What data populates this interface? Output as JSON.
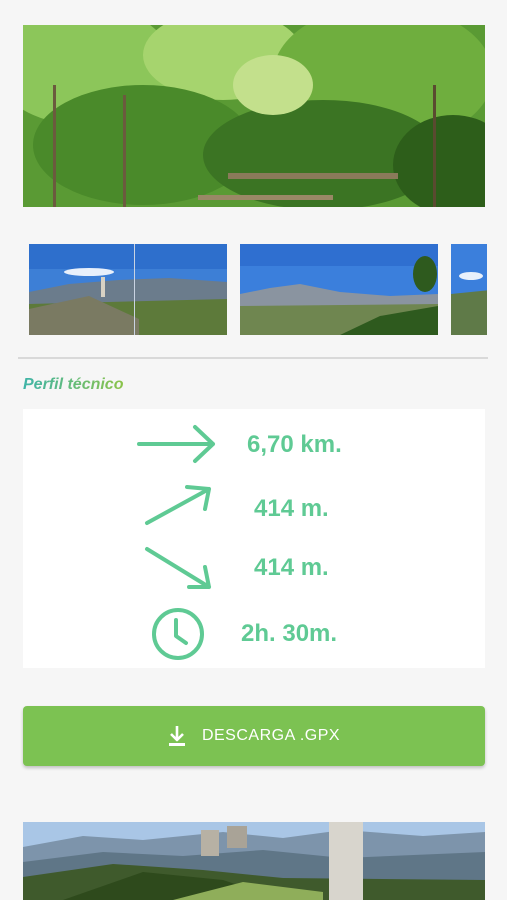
{
  "section": {
    "title": "Perfil técnico"
  },
  "stats": {
    "distance": {
      "icon": "arrow-right-icon",
      "value": "6,70 km."
    },
    "ascent": {
      "icon": "arrow-up-right-icon",
      "value": "414 m."
    },
    "descent": {
      "icon": "arrow-down-right-icon",
      "value": "414 m."
    },
    "duration": {
      "icon": "clock-icon",
      "value": "2h. 30m."
    }
  },
  "download": {
    "label": "DESCARGA .GPX",
    "icon": "download-icon"
  },
  "colors": {
    "accent_green": "#5fca94",
    "button_green": "#7cc252",
    "title_teal": "#3fb4a8"
  }
}
